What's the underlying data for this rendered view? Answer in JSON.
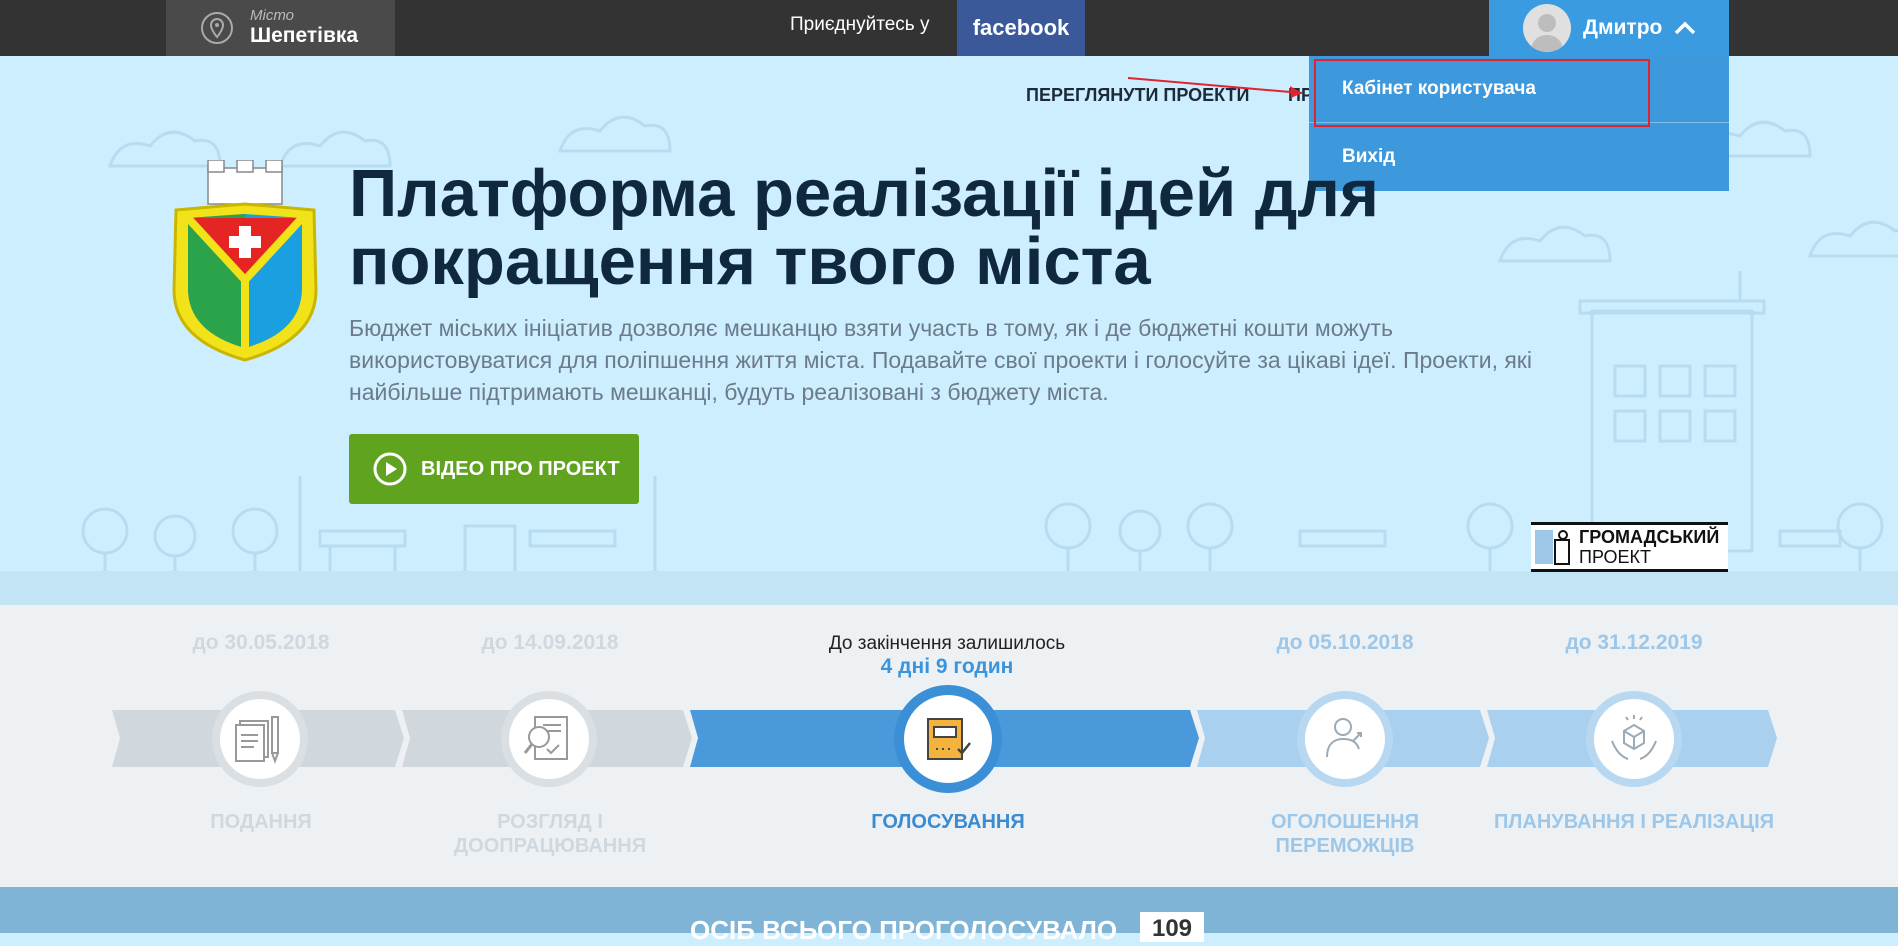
{
  "header": {
    "city_label": "Місто",
    "city_name": "Шепетівка",
    "join_text": "Приєднуйтесь у",
    "facebook_label": "facebook",
    "user_name": "Дмитро"
  },
  "dropdown": {
    "items": [
      {
        "label": "Кабінет користувача"
      },
      {
        "label": "Вихід"
      }
    ]
  },
  "nav": {
    "view_projects": "ПЕРЕГЛЯНУТИ ПРОЕКТИ",
    "partial": "ПР"
  },
  "hero": {
    "title": "Платформа реалізації ідей для покращення твого міста",
    "description": "Бюджет міських ініціатив дозволяє мешканцю взяти участь в тому, як і де бюджетні кошти можуть використовуватися для поліпшення життя міста. Подавайте свої проекти і голосуйте за цікаві ідеї. Проекти, які найбільше підтримають мешканці, будуть реалізовані з бюджету міста.",
    "video_button": "ВІДЕО ПРО ПРОЕКТ"
  },
  "partner_logo": {
    "line1": "ГРОМАДСЬКИЙ",
    "line2": "ПРОЕКТ"
  },
  "steps": {
    "remaining_label": "До закінчення залишилось",
    "remaining_value": "4 дні 9 годин",
    "items": [
      {
        "date": "до 30.05.2018",
        "label": "ПОДАННЯ",
        "state": "done"
      },
      {
        "date": "до 14.09.2018",
        "label": "РОЗГЛЯД І ДООПРАЦЮВАННЯ",
        "state": "done"
      },
      {
        "date": "",
        "label": "ГОЛОСУВАННЯ",
        "state": "current"
      },
      {
        "date": "до 05.10.2018",
        "label": "ОГОЛОШЕННЯ ПЕРЕМОЖЦІВ",
        "state": "future"
      },
      {
        "date": "до 31.12.2019",
        "label": "ПЛАНУВАННЯ І РЕАЛІЗАЦІЯ",
        "state": "future"
      }
    ]
  },
  "footer_bar": {
    "text": "ОСІБ ВСЬОГО ПРОГОЛОСУВАЛО",
    "count": "109"
  },
  "colors": {
    "topbar": "#333333",
    "accent_blue": "#3b9be0",
    "facebook": "#3b5998",
    "video_green": "#5fa31f",
    "highlight_red": "#e0232e",
    "hero_bg": "#cdeeff"
  }
}
